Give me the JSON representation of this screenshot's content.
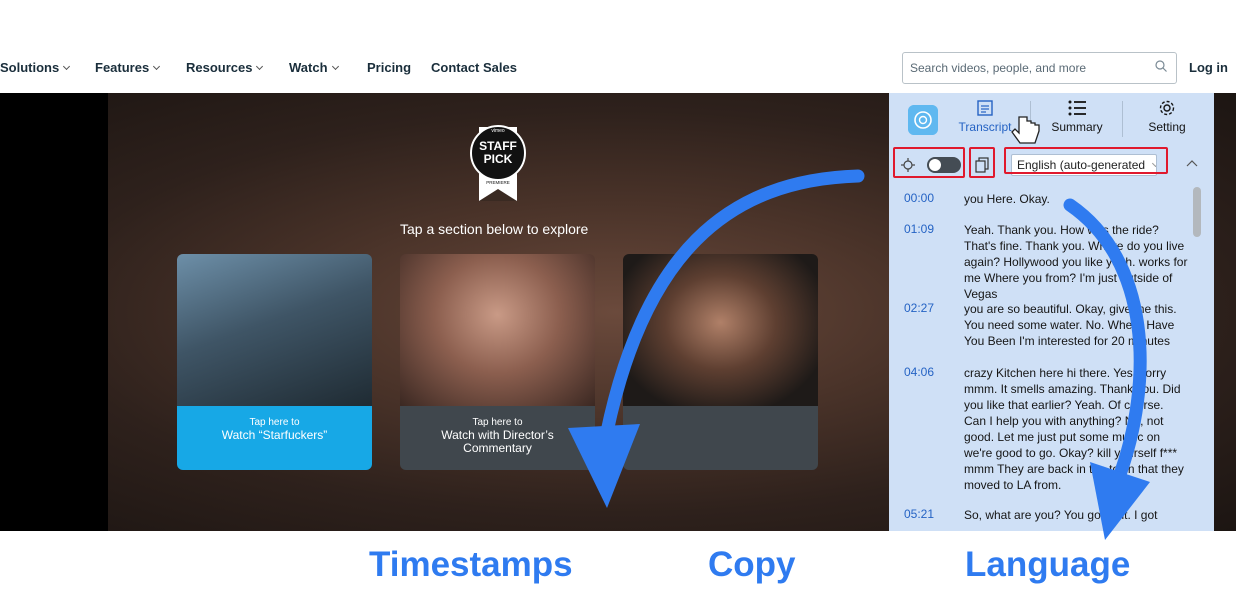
{
  "nav": {
    "items": [
      {
        "label": "Solutions",
        "has_dropdown": true
      },
      {
        "label": "Features",
        "has_dropdown": true
      },
      {
        "label": "Resources",
        "has_dropdown": true
      },
      {
        "label": "Watch",
        "has_dropdown": true
      },
      {
        "label": "Pricing",
        "has_dropdown": false
      },
      {
        "label": "Contact Sales",
        "has_dropdown": false
      }
    ],
    "search_placeholder": "Search videos, people, and more",
    "login_label": "Log in"
  },
  "video": {
    "badge": {
      "top": "vimeo",
      "line1": "STAFF",
      "line2": "PICK",
      "bottom": "PREMIERE"
    },
    "tap_title": "Tap a section below to explore",
    "cards": [
      {
        "line1": "Tap here to",
        "line2": "Watch “Starfuckers”",
        "line3": "",
        "color": "#17a8e6"
      },
      {
        "line1": "Tap here to",
        "line2": "Watch with Director’s",
        "line3": "Commentary",
        "color": "#40474d"
      },
      {
        "line1": "",
        "line2": "",
        "line3": "",
        "color": "#40474d"
      }
    ]
  },
  "panel": {
    "tabs": [
      {
        "label": "Transcript",
        "icon": "transcript-icon",
        "active": true
      },
      {
        "label": "Summary",
        "icon": "list-icon",
        "active": false
      },
      {
        "label": "Setting",
        "icon": "gear-icon",
        "active": false
      }
    ],
    "language": "English (auto-generated",
    "transcript": [
      {
        "time": "00:00",
        "text": "you Here. Okay."
      },
      {
        "time": "01:09",
        "text": "Yeah. Thank you. How was the ride? That's fine. Thank you. Where do you live again? Hollywood you like yeah. works for me Where you from? I'm just outside of Vegas"
      },
      {
        "time": "02:27",
        "text": "you are so beautiful. Okay, give me this. You need some water. No. Where Have You Been I'm interested for 20 minutes"
      },
      {
        "time": "04:06",
        "text": "crazy Kitchen here hi there. Yes, sorry mmm. It smells amazing. Thank you. Did you like that earlier? Yeah. Of course. Can I help you with anything? No, not good. Let me just put some music on we're good to go. Okay? kill yourself f*** mmm They are back in the town that they moved to LA from."
      },
      {
        "time": "05:21",
        "text": "So, what are you? You go for it. I got"
      }
    ]
  },
  "captions": {
    "timestamps": "Timestamps",
    "copy": "Copy",
    "language": "Language"
  },
  "colors": {
    "accent": "#2f7bf0",
    "highlight_box": "#e0192d",
    "panel_bg": "#cfe0f6",
    "timestamp": "#2563c4"
  }
}
